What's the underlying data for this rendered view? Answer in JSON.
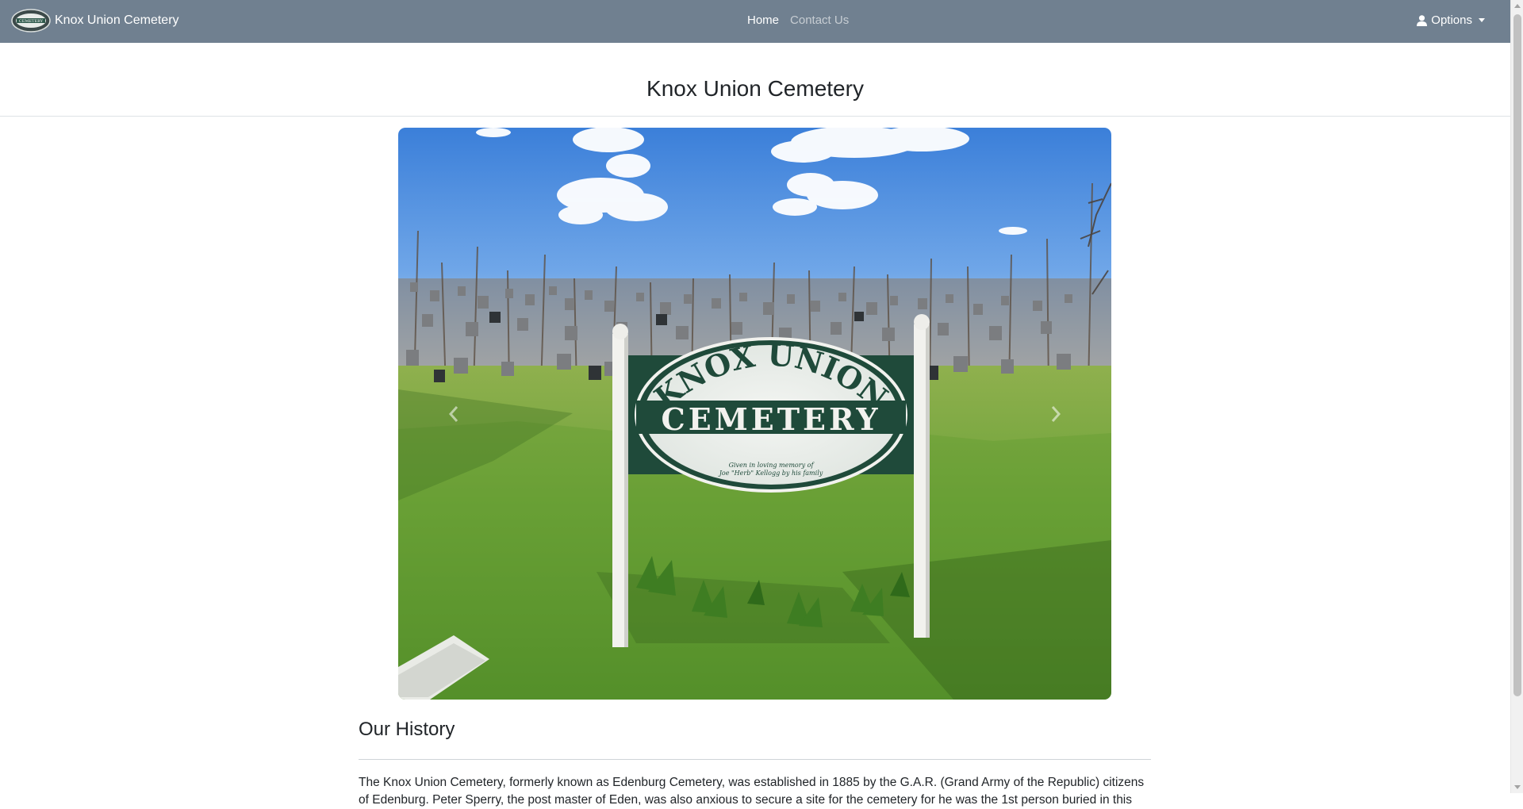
{
  "navbar": {
    "brand": "Knox Union Cemetery",
    "logo_text": "CEMETERY",
    "links": [
      {
        "label": "Home",
        "active": true
      },
      {
        "label": "Contact Us",
        "active": false
      }
    ],
    "options_label": "Options",
    "background_color": "#708090"
  },
  "page": {
    "title": "Knox Union Cemetery"
  },
  "carousel": {
    "sign_line1": "KNOX UNION",
    "sign_line2": "CEMETERY",
    "sign_dedication_1": "Given in loving memory of",
    "sign_dedication_2": "Joe \"Herb\" Kellogg by his family",
    "prev_icon": "chevron-left-icon",
    "next_icon": "chevron-right-icon"
  },
  "history": {
    "heading": "Our History",
    "paragraph": "The Knox Union Cemetery, formerly known as Edenburg Cemetery, was established in 1885 by the G.A.R. (Grand Army of the Republic) citizens of Edenburg. Peter Sperry, the post master of Eden, was also anxious to secure a site for the cemetery for he was the 1st person buried in this"
  }
}
